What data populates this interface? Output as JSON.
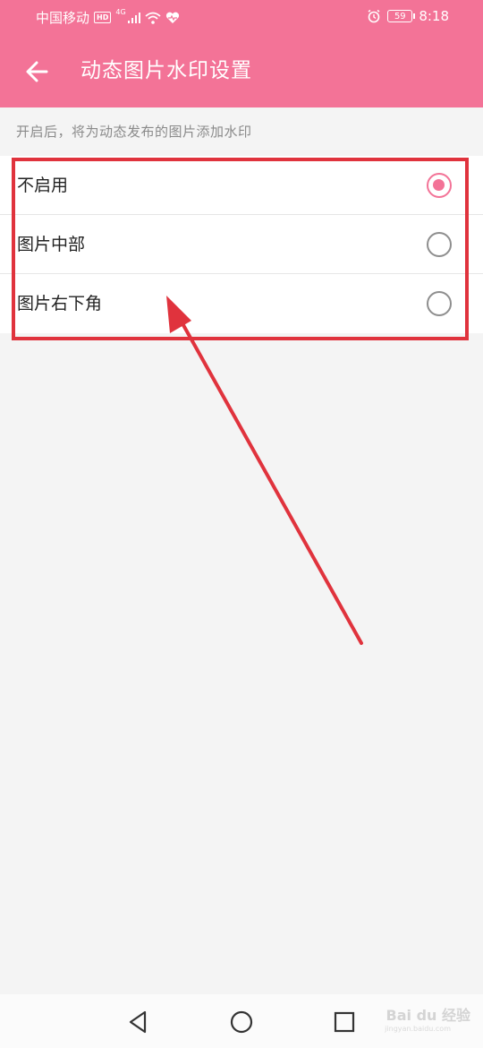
{
  "status_bar": {
    "carrier": "中国移动",
    "hd": "HD",
    "network": "4G",
    "battery": "59",
    "time": "8:18"
  },
  "header": {
    "title": "动态图片水印设置"
  },
  "hint": "开启后，将为动态发布的图片添加水印",
  "options": [
    {
      "label": "不启用",
      "selected": true
    },
    {
      "label": "图片中部",
      "selected": false
    },
    {
      "label": "图片右下角",
      "selected": false
    }
  ],
  "watermark": {
    "text": "Bai du 经验",
    "sub": "jingyan.baidu.com"
  },
  "colors": {
    "accent": "#f37397",
    "annotation": "#e0333d"
  }
}
